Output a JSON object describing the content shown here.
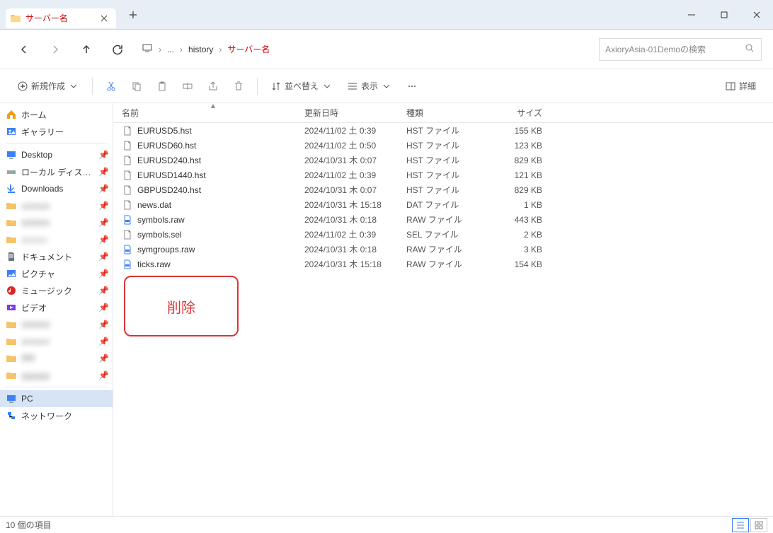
{
  "colors": {
    "accent": "#c00",
    "tab_bg": "#e8eef6"
  },
  "titlebar": {
    "tab_label": "サーバー名",
    "tab_icon": "folder-icon"
  },
  "nav": {
    "crumbs": [
      {
        "label": "...",
        "current": false
      },
      {
        "label": "history",
        "current": false
      },
      {
        "label": "サーバー名",
        "current": true
      }
    ],
    "search_placeholder": "AxioryAsia-01Demoの検索"
  },
  "toolbar": {
    "new_label": "新規作成",
    "sort_label": "並べ替え",
    "view_label": "表示",
    "details_label": "詳細"
  },
  "sidebar": {
    "home": "ホーム",
    "gallery": "ギャラリー",
    "desktop": "Desktop",
    "local_disk": "ローカル ディスク (C:)",
    "downloads": "Downloads",
    "documents": "ドキュメント",
    "pictures": "ピクチャ",
    "music": "ミュージック",
    "videos": "ビデオ",
    "pc": "PC",
    "network": "ネットワーク",
    "blurred": [
      "aaaaaa",
      "bbbbbb",
      "cccccc",
      "dddddd",
      "eeeeee",
      "ffffff",
      "gggggg"
    ]
  },
  "columns": {
    "name": "名前",
    "date": "更新日時",
    "type": "種類",
    "size": "サイズ"
  },
  "files": [
    {
      "name": "EURUSD5.hst",
      "date": "2024/11/02 土 0:39",
      "type": "HST ファイル",
      "size": "155 KB",
      "icon": "file"
    },
    {
      "name": "EURUSD60.hst",
      "date": "2024/11/02 土 0:50",
      "type": "HST ファイル",
      "size": "123 KB",
      "icon": "file"
    },
    {
      "name": "EURUSD240.hst",
      "date": "2024/10/31 木 0:07",
      "type": "HST ファイル",
      "size": "829 KB",
      "icon": "file"
    },
    {
      "name": "EURUSD1440.hst",
      "date": "2024/11/02 土 0:39",
      "type": "HST ファイル",
      "size": "121 KB",
      "icon": "file"
    },
    {
      "name": "GBPUSD240.hst",
      "date": "2024/10/31 木 0:07",
      "type": "HST ファイル",
      "size": "829 KB",
      "icon": "file"
    },
    {
      "name": "news.dat",
      "date": "2024/10/31 木 15:18",
      "type": "DAT ファイル",
      "size": "1 KB",
      "icon": "file"
    },
    {
      "name": "symbols.raw",
      "date": "2024/10/31 木 0:18",
      "type": "RAW ファイル",
      "size": "443 KB",
      "icon": "raw"
    },
    {
      "name": "symbols.sel",
      "date": "2024/11/02 土 0:39",
      "type": "SEL ファイル",
      "size": "2 KB",
      "icon": "file"
    },
    {
      "name": "symgroups.raw",
      "date": "2024/10/31 木 0:18",
      "type": "RAW ファイル",
      "size": "3 KB",
      "icon": "raw"
    },
    {
      "name": "ticks.raw",
      "date": "2024/10/31 木 15:18",
      "type": "RAW ファイル",
      "size": "154 KB",
      "icon": "raw"
    }
  ],
  "annotation": "削除",
  "status": {
    "item_count": "10 個の項目"
  }
}
